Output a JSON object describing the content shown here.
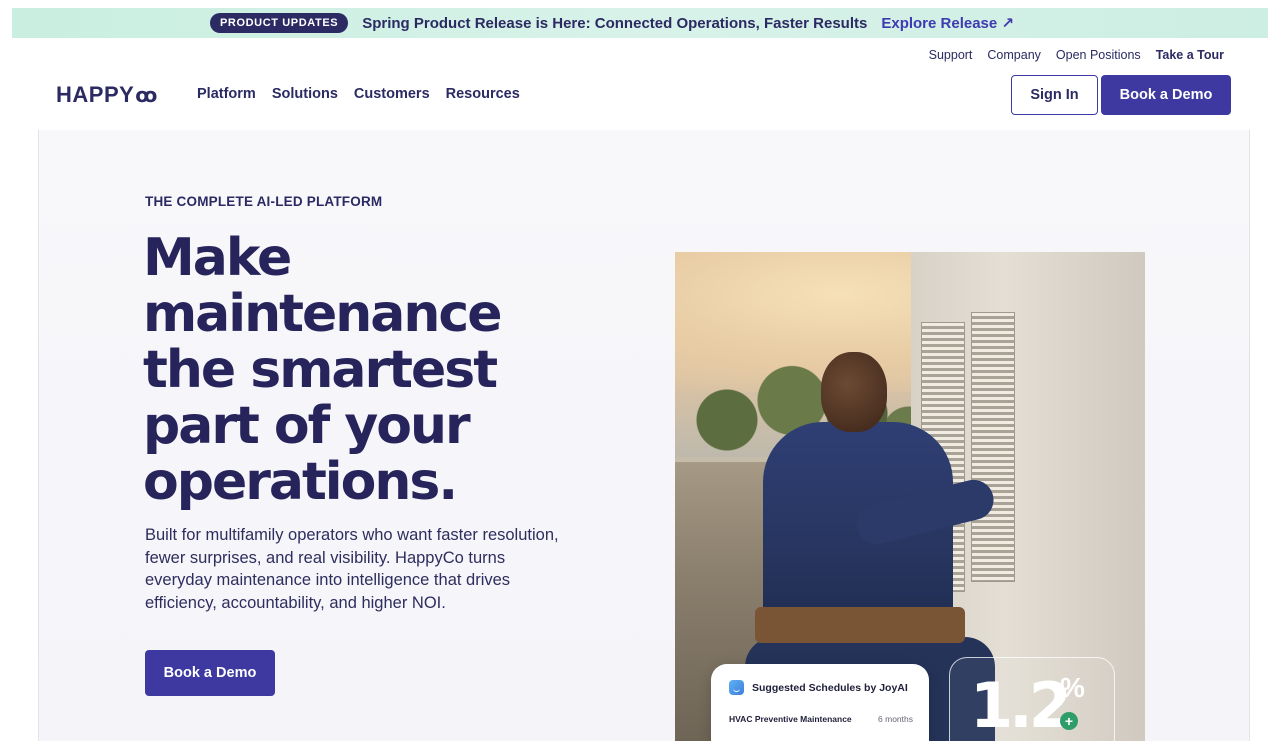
{
  "banner": {
    "pill": "PRODUCT UPDATES",
    "headline": "Spring Product Release is Here: Connected Operations, Faster Results",
    "link": "Explore Release ↗"
  },
  "util_nav": {
    "items": [
      "Support",
      "Company",
      "Open Positions"
    ],
    "tour": "Take a Tour"
  },
  "brand": {
    "name": "HAPPY",
    "mark": "ꝏ"
  },
  "main_nav": {
    "items": [
      "Platform",
      "Solutions",
      "Customers",
      "Resources"
    ]
  },
  "header_actions": {
    "signin": "Sign In",
    "demo": "Book a Demo"
  },
  "hero": {
    "eyebrow": "THE COMPLETE AI-LED PLATFORM",
    "title_lines": [
      "Make",
      "maintenance",
      "the smartest",
      "part of your",
      "operations."
    ],
    "subtitle": "Built for multifamily operators who want faster resolution, fewer surprises, and real visibility. HappyCo turns everyday maintenance into intelligence that drives efficiency, accountability, and higher NOI.",
    "cta": "Book a Demo"
  },
  "schedule_card": {
    "title": "Suggested Schedules by JoyAI",
    "row_name": "HVAC Preventive Maintenance",
    "row_duration": "6 months"
  },
  "stat_card": {
    "value": "1.2",
    "unit": "%",
    "sign": "+"
  },
  "colors": {
    "brand_navy": "#2b2a63",
    "accent_purple": "#3d39a0",
    "banner_mint": "#d3f1e6",
    "positive_green": "#2f9d6a"
  }
}
